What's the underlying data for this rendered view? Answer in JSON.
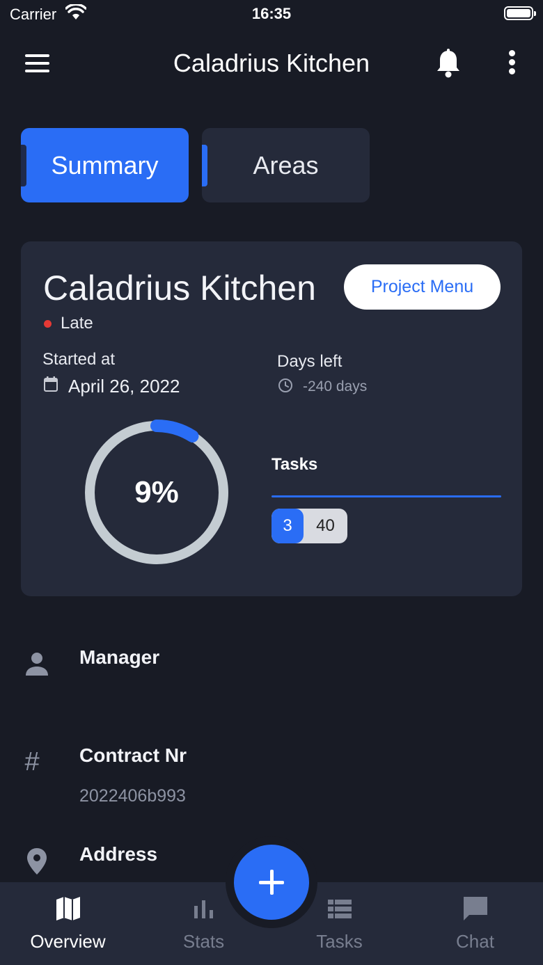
{
  "status_bar": {
    "carrier": "Carrier",
    "time": "16:35"
  },
  "header": {
    "title": "Caladrius Kitchen"
  },
  "tabs": [
    {
      "label": "Summary",
      "active": true
    },
    {
      "label": "Areas",
      "active": false
    }
  ],
  "project": {
    "title": "Caladrius Kitchen",
    "menu_label": "Project Menu",
    "status": "Late",
    "status_color": "#e53935",
    "started_label": "Started at",
    "started_date": "April 26, 2022",
    "days_left_label": "Days left",
    "days_left_value": "-240 days",
    "progress": {
      "percent_label": "9%",
      "value": 0.09
    },
    "tasks": {
      "label": "Tasks",
      "done": "3",
      "total": "40"
    }
  },
  "info": {
    "manager": {
      "label": "Manager"
    },
    "contract": {
      "label": "Contract Nr",
      "value": "2022406b993"
    },
    "address": {
      "label": "Address"
    }
  },
  "bottom_nav": [
    {
      "label": "Overview",
      "icon": "map-icon",
      "active": true
    },
    {
      "label": "Stats",
      "icon": "bar-chart-icon",
      "active": false
    },
    {
      "label": "Tasks",
      "icon": "list-icon",
      "active": false
    },
    {
      "label": "Chat",
      "icon": "chat-icon",
      "active": false
    }
  ],
  "colors": {
    "accent": "#2a6df5",
    "background": "#181b25",
    "card": "#252a3a"
  }
}
